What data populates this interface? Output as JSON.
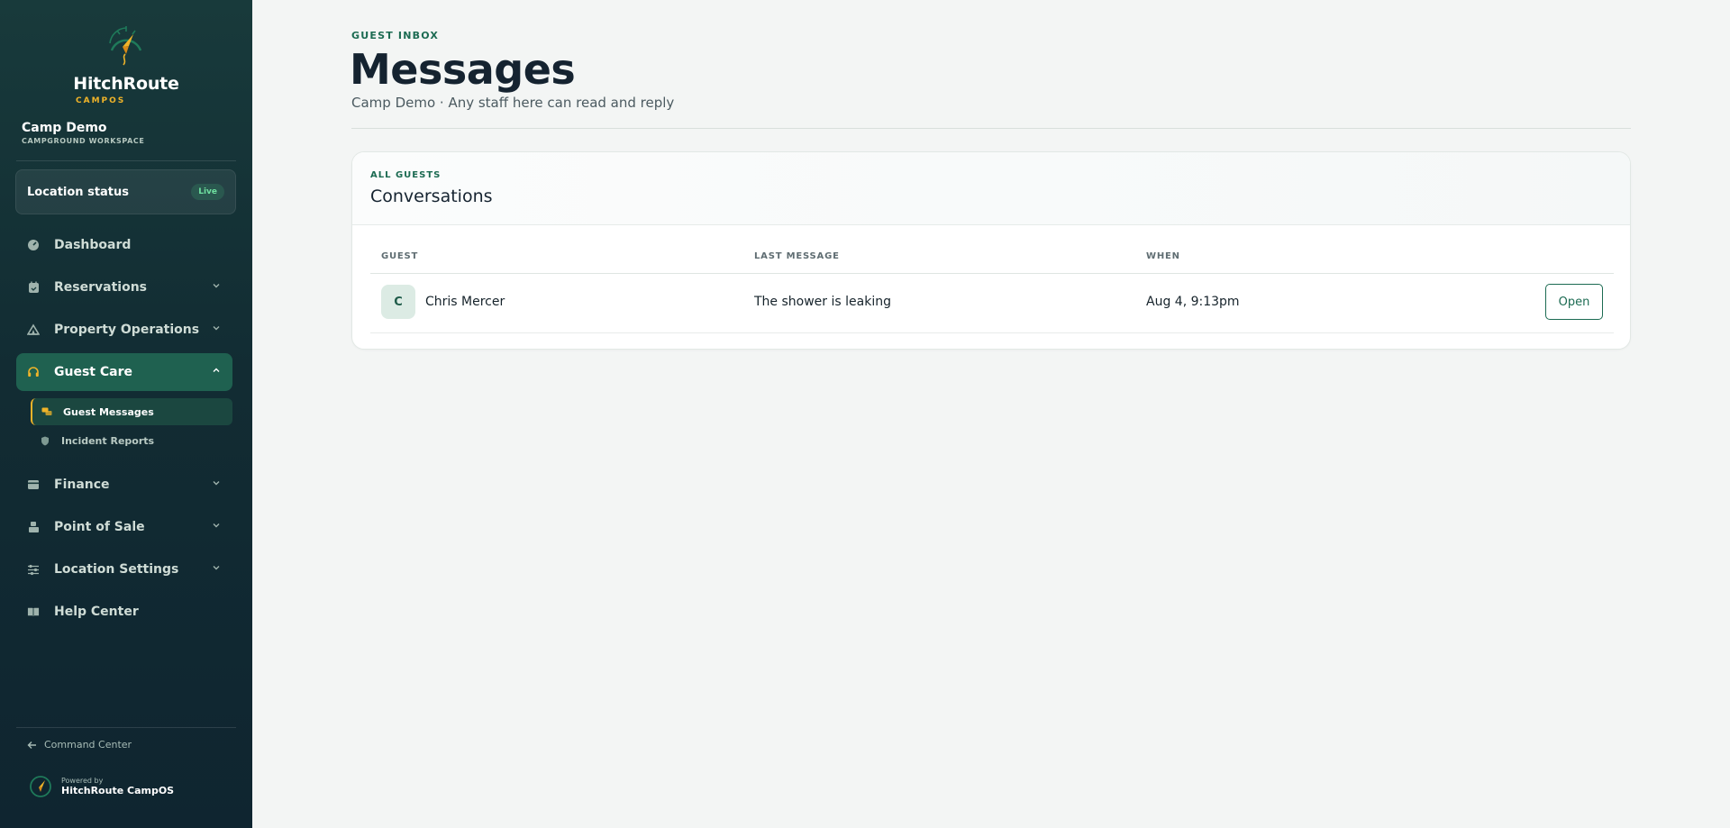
{
  "brand": {
    "name": "HitchRoute",
    "sub": "CAMPOS"
  },
  "workspace": {
    "name": "Camp Demo",
    "sub": "CAMPGROUND WORKSPACE"
  },
  "location_status": {
    "label": "Location status",
    "badge": "Live"
  },
  "nav": {
    "dashboard": "Dashboard",
    "reservations": "Reservations",
    "property_operations": "Property Operations",
    "guest_care": "Guest Care",
    "guest_care_items": [
      "Guest Messages",
      "Incident Reports"
    ],
    "finance": "Finance",
    "point_of_sale": "Point of Sale",
    "location_settings": "Location Settings",
    "help_center": "Help Center"
  },
  "footer": {
    "command_center": "Command Center",
    "powered_by": "Powered by",
    "powered_name": "HitchRoute CampOS"
  },
  "page": {
    "eyebrow": "GUEST INBOX",
    "title": "Messages",
    "subtitle": "Camp Demo · Any staff here can read and reply"
  },
  "conversations": {
    "eyebrow": "ALL GUESTS",
    "title": "Conversations",
    "columns": [
      "GUEST",
      "LAST MESSAGE",
      "WHEN"
    ],
    "rows": [
      {
        "initial": "C",
        "guest": "Chris Mercer",
        "last_message": "The shower is leaking",
        "when": "Aug 4, 9:13pm",
        "action": "Open"
      }
    ]
  },
  "colors": {
    "sidebar": "#183a3b",
    "accent": "#1c6b52",
    "gold": "#f0b429",
    "active_nav": "#1f6150"
  }
}
